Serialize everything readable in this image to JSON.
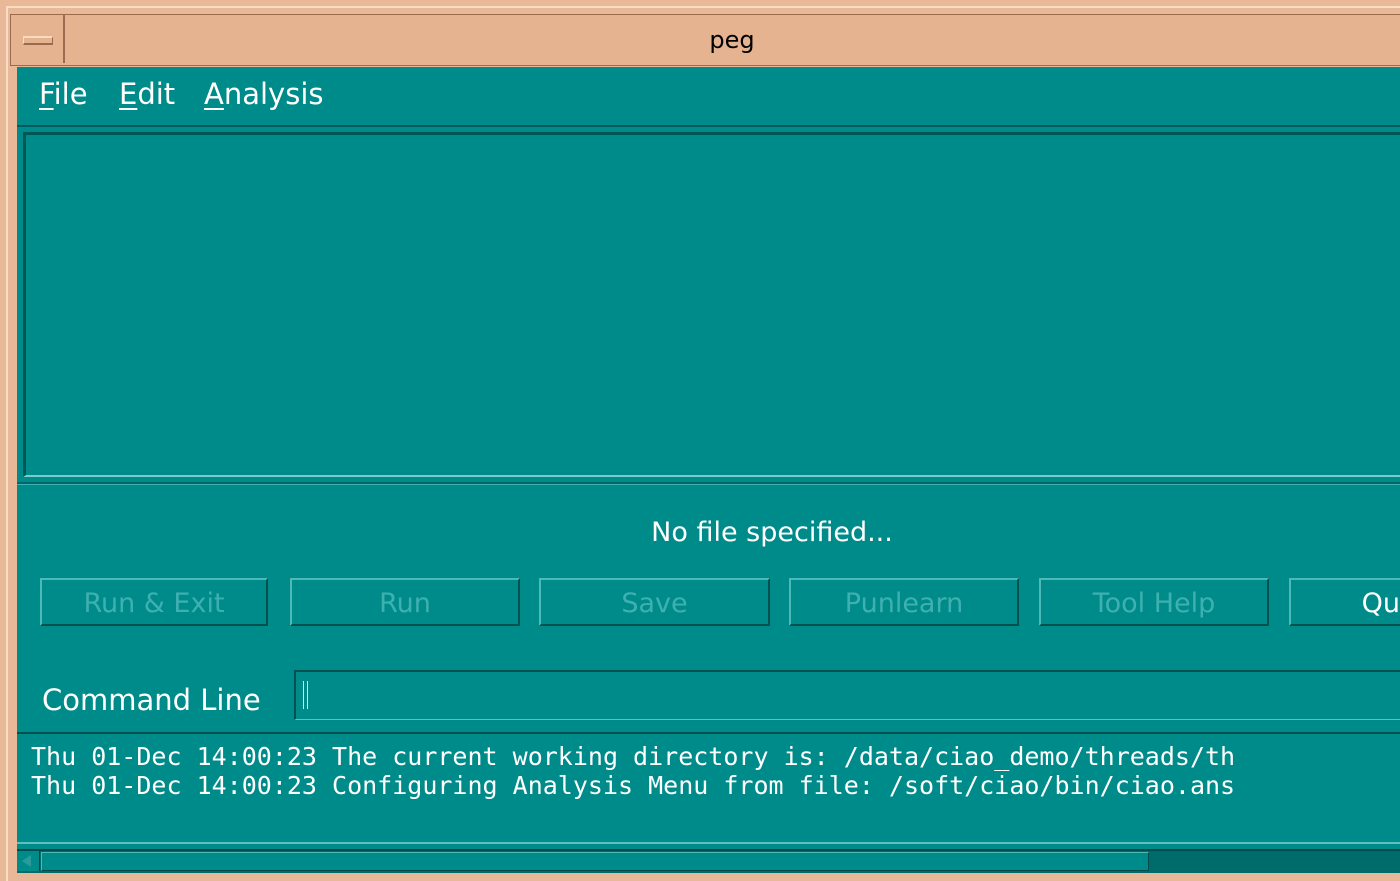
{
  "window": {
    "title": "peg"
  },
  "menu": [
    {
      "first": "F",
      "rest": "ile"
    },
    {
      "first": "E",
      "rest": "dit"
    },
    {
      "first": "A",
      "rest": "nalysis"
    }
  ],
  "status_text": "No file specified...",
  "buttons": [
    {
      "label": "Run & Exit"
    },
    {
      "label": "Run"
    },
    {
      "label": "Save"
    },
    {
      "label": "Punlearn"
    },
    {
      "label": "Tool Help"
    },
    {
      "label": "Qu"
    }
  ],
  "command_line": {
    "label": "Command Line",
    "value": ""
  },
  "log": [
    "Thu 01-Dec 14:00:23 The current working directory is: /data/ciao_demo/threads/th",
    "Thu 01-Dec 14:00:23 Configuring Analysis Menu from file: /soft/ciao/bin/ciao.ans"
  ],
  "colors": {
    "background": "#008b8b",
    "titlebar": "#e6b391"
  }
}
